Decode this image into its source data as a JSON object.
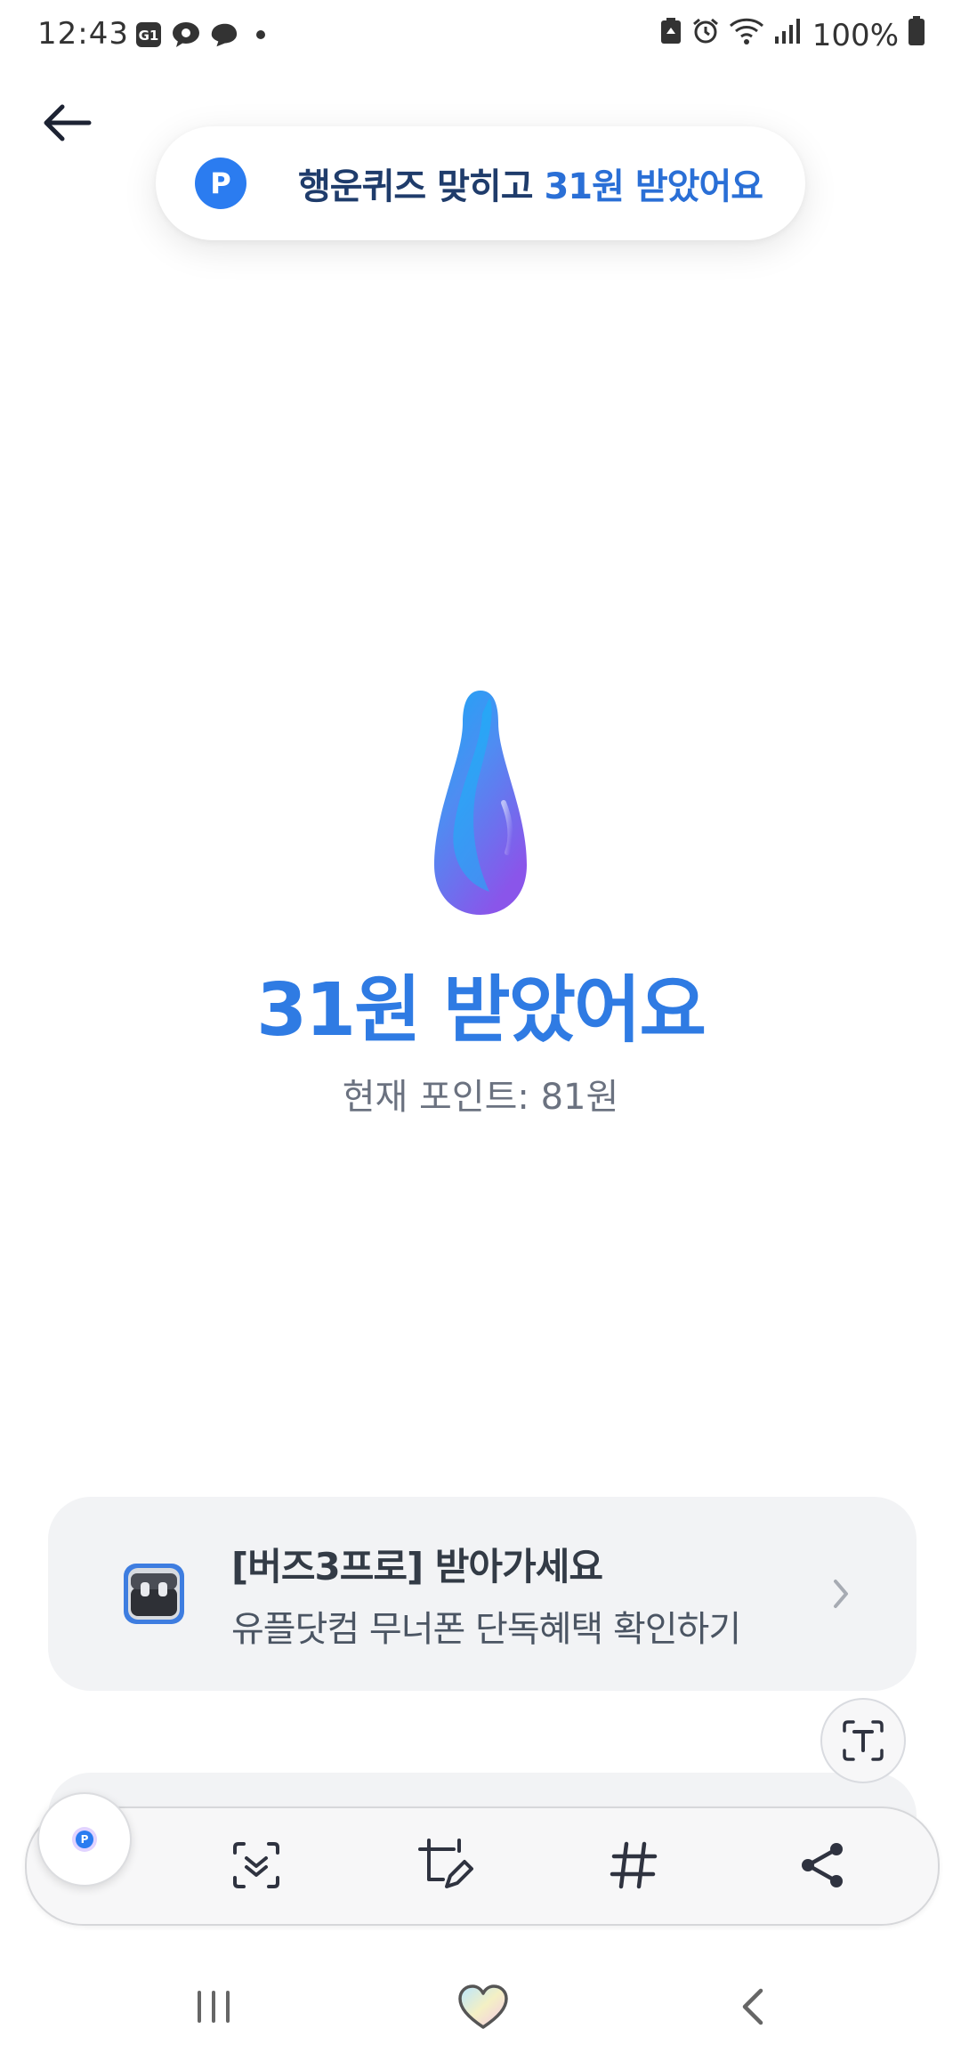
{
  "status_bar": {
    "time": "12:43",
    "battery": "100%",
    "left_icons": [
      "g1-app-icon",
      "talk-icon",
      "chat-bubble-icon",
      "dot-icon"
    ],
    "right_icons": [
      "recycle-icon",
      "alarm-icon",
      "wifi-icon",
      "signal-icon",
      "battery-icon"
    ]
  },
  "toast": {
    "icon_letter": "P",
    "text_part1": "행운퀴즈 맞히고 ",
    "text_part2": "31원 받았어요"
  },
  "reward": {
    "title": "31원 받았어요",
    "current_points": "현재 포인트: 81원"
  },
  "promo": {
    "title": "[버즈3프로] 받아가세요",
    "subtitle": "유플닷컴 무너폰 단독혜택 확인하기"
  },
  "colors": {
    "accent_blue": "#2f7be3",
    "point_icon": "#2b7cf0",
    "card_bg": "#f2f3f5"
  },
  "toolbar": {
    "thumb_letter": "P",
    "tools": [
      "scroll-capture-icon",
      "crop-edit-icon",
      "hashtag-icon",
      "share-icon"
    ]
  },
  "navigation": [
    "recents-icon",
    "home-heart-icon",
    "back-chevron-icon"
  ]
}
